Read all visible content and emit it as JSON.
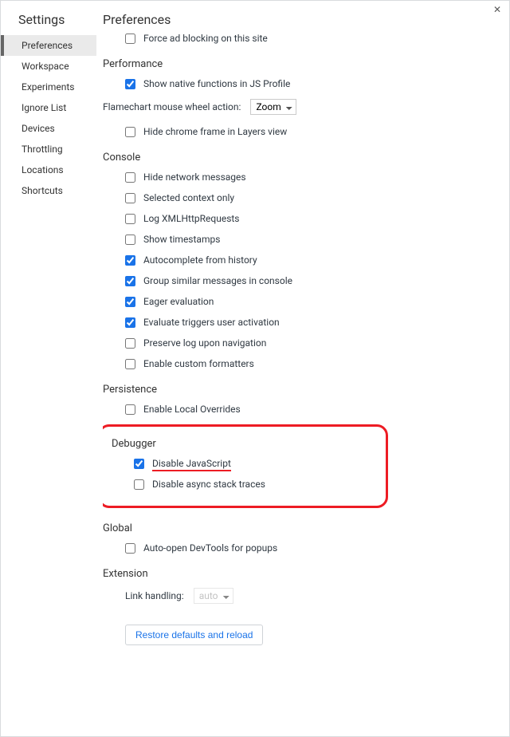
{
  "close_glyph": "✕",
  "sidebar": {
    "title": "Settings",
    "tabs": [
      {
        "label": "Preferences",
        "selected": true
      },
      {
        "label": "Workspace"
      },
      {
        "label": "Experiments"
      },
      {
        "label": "Ignore List"
      },
      {
        "label": "Devices"
      },
      {
        "label": "Throttling"
      },
      {
        "label": "Locations"
      },
      {
        "label": "Shortcuts"
      }
    ]
  },
  "main": {
    "title": "Preferences",
    "top_stray": {
      "label": "Force ad blocking on this site",
      "checked": false
    },
    "performance": {
      "title": "Performance",
      "native_fn": {
        "label": "Show native functions in JS Profile",
        "checked": true
      },
      "flame_label": "Flamechart mouse wheel action:",
      "flame_value": "Zoom",
      "hide_frame": {
        "label": "Hide chrome frame in Layers view",
        "checked": false
      }
    },
    "console": {
      "title": "Console",
      "opts": [
        {
          "label": "Hide network messages",
          "checked": false
        },
        {
          "label": "Selected context only",
          "checked": false
        },
        {
          "label": "Log XMLHttpRequests",
          "checked": false
        },
        {
          "label": "Show timestamps",
          "checked": false
        },
        {
          "label": "Autocomplete from history",
          "checked": true
        },
        {
          "label": "Group similar messages in console",
          "checked": true
        },
        {
          "label": "Eager evaluation",
          "checked": true
        },
        {
          "label": "Evaluate triggers user activation",
          "checked": true
        },
        {
          "label": "Preserve log upon navigation",
          "checked": false
        },
        {
          "label": "Enable custom formatters",
          "checked": false
        }
      ]
    },
    "persistence": {
      "title": "Persistence",
      "local_ovr": {
        "label": "Enable Local Overrides",
        "checked": false
      }
    },
    "debugger": {
      "title": "Debugger",
      "disable_js": {
        "label": "Disable JavaScript",
        "checked": true
      },
      "disable_async": {
        "label": "Disable async stack traces",
        "checked": false
      }
    },
    "global": {
      "title": "Global",
      "auto_open": {
        "label": "Auto-open DevTools for popups",
        "checked": false
      }
    },
    "extension": {
      "title": "Extension",
      "link_label": "Link handling:",
      "link_value": "auto"
    },
    "restore": "Restore defaults and reload"
  }
}
